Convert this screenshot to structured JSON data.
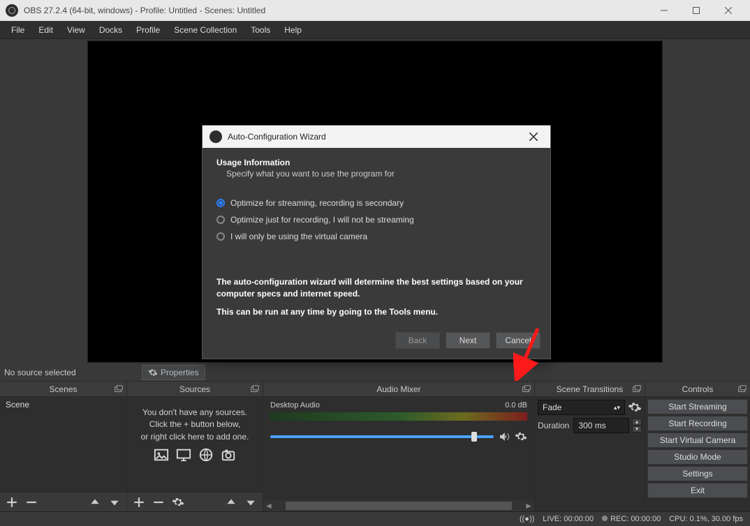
{
  "titlebar": {
    "title": "OBS 27.2.4 (64-bit, windows) - Profile: Untitled - Scenes: Untitled"
  },
  "menu": {
    "items": [
      "File",
      "Edit",
      "View",
      "Docks",
      "Profile",
      "Scene Collection",
      "Tools",
      "Help"
    ]
  },
  "toolbar": {
    "no_source": "No source selected",
    "properties": "Properties"
  },
  "panels": {
    "scenes": {
      "title": "Scenes",
      "items": [
        "Scene"
      ]
    },
    "sources": {
      "title": "Sources",
      "empty1": "You don't have any sources.",
      "empty2": "Click the + button below,",
      "empty3": "or right click here to add one."
    },
    "mixer": {
      "title": "Audio Mixer",
      "channel": "Desktop Audio",
      "db": "0.0 dB"
    },
    "transitions": {
      "title": "Scene Transitions",
      "selected": "Fade",
      "duration_label": "Duration",
      "duration_value": "300 ms"
    },
    "controls": {
      "title": "Controls",
      "buttons": [
        "Start Streaming",
        "Start Recording",
        "Start Virtual Camera",
        "Studio Mode",
        "Settings",
        "Exit"
      ]
    }
  },
  "status": {
    "live": "LIVE: 00:00:00",
    "rec": "REC: 00:00:00",
    "cpu": "CPU: 0.1%, 30.00 fps"
  },
  "wizard": {
    "title": "Auto-Configuration Wizard",
    "heading": "Usage Information",
    "subheading": "Specify what you want to use the program for",
    "opts": [
      "Optimize for streaming, recording is secondary",
      "Optimize just for recording, I will not be streaming",
      "I will only be using the virtual camera"
    ],
    "desc1": "The auto-configuration wizard will determine the best settings based on your computer specs and internet speed.",
    "desc2": "This can be run at any time by going to the Tools menu.",
    "back": "Back",
    "next": "Next",
    "cancel": "Cancel"
  }
}
